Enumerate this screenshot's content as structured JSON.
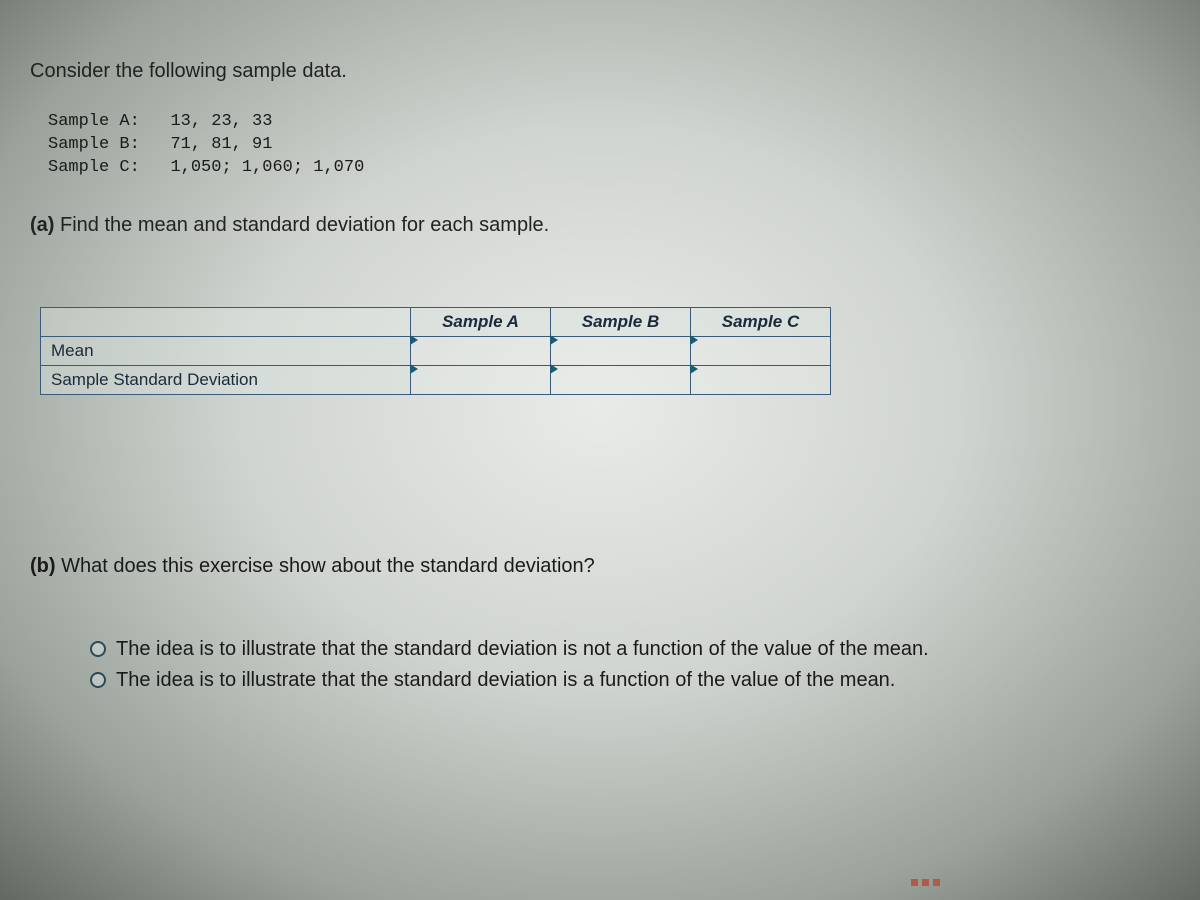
{
  "intro": "Consider the following sample data.",
  "samples": {
    "a_label": "Sample A:",
    "a_values": "13, 23, 33",
    "b_label": "Sample B:",
    "b_values": "71, 81, 91",
    "c_label": "Sample C:",
    "c_values": "1,050; 1,060; 1,070"
  },
  "part_a": {
    "marker": "(a)",
    "text": "Find the mean and standard deviation for each sample."
  },
  "table": {
    "headers": {
      "a": "Sample A",
      "b": "Sample B",
      "c": "Sample C"
    },
    "rows": {
      "mean": "Mean",
      "std": "Sample Standard Deviation"
    },
    "cells": {
      "mean_a": "",
      "mean_b": "",
      "mean_c": "",
      "std_a": "",
      "std_b": "",
      "std_c": ""
    }
  },
  "part_b": {
    "marker": "(b)",
    "text": "What does this exercise show about the standard deviation?"
  },
  "options": {
    "opt1": "The idea is to illustrate that the standard deviation is not a function of the value of the mean.",
    "opt2": "The idea is to illustrate that the standard deviation is a function of the value of the mean."
  }
}
